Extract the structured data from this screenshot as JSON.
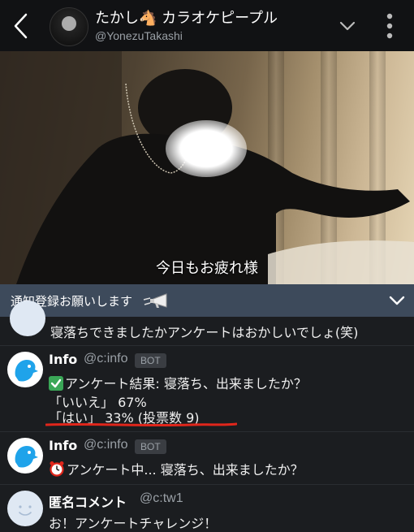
{
  "header": {
    "title": "たかし🐴 カラオケピープル",
    "handle": "@YonezuTakashi"
  },
  "video": {
    "caption": "今日もお疲れ様"
  },
  "notify": {
    "text": "通知登録お願いします",
    "megaphone_icon": "megaphone-icon"
  },
  "feed": {
    "prev_comment": "寝落ちできましたかアンケートはおかしいでしょ(笑)",
    "posts": [
      {
        "name": "Info",
        "id": "@c:info",
        "badge": "BOT",
        "lines": [
          "アンケート結果: 寝落ち、出来ましたか？",
          "「いいえ」 67%",
          "「はい」 33%   (投票数 9)"
        ],
        "icon": "check-mark-icon"
      },
      {
        "name": "Info",
        "id": "@c:info",
        "badge": "BOT",
        "lines": [
          "アンケート中... 寝落ち、出来ましたか？"
        ],
        "icon": "alarm-clock-icon"
      },
      {
        "name": "匿名コメント",
        "id": "@c:tw1",
        "lines": [
          "お！アンケートチャレンジ！"
        ]
      }
    ]
  },
  "colors": {
    "header_bg": "#111214",
    "notify_bg": "#3d4a5b",
    "feed_bg": "#1b1d20",
    "underline": "#e0261b",
    "check_green": "#3aa757",
    "bot_blue": "#1fa3ea"
  }
}
